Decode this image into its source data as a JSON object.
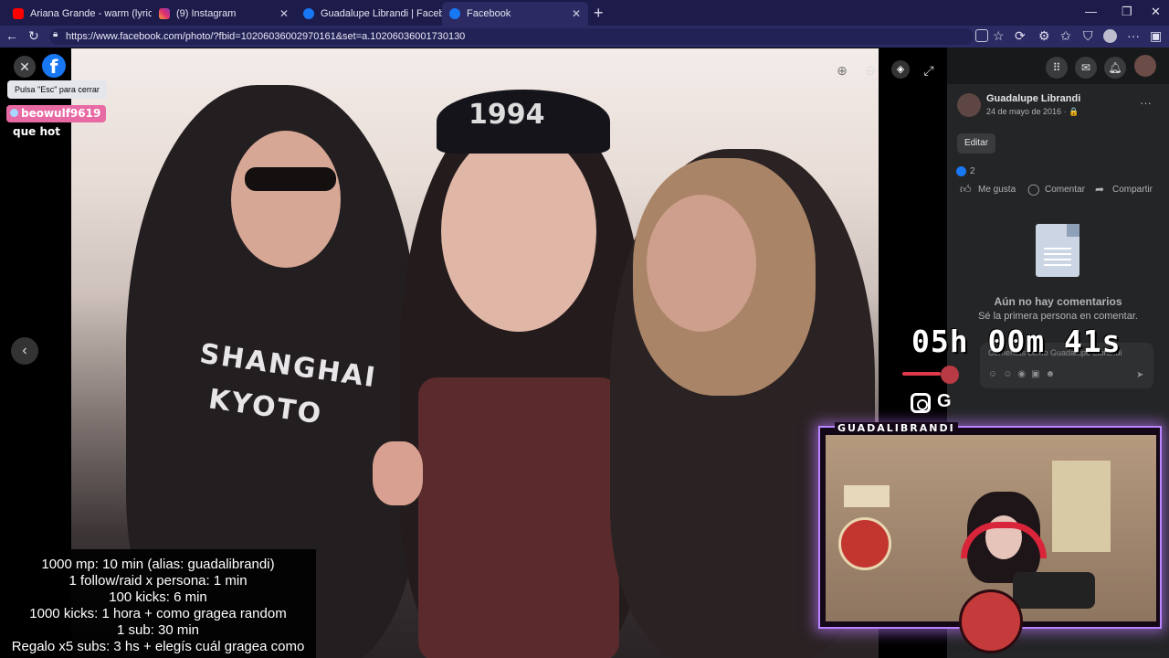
{
  "browser": {
    "tabs": [
      {
        "title": "Ariana Grande - warm (lyric vi",
        "favicon": "youtube-icon"
      },
      {
        "title": "(9) Instagram",
        "favicon": "instagram-icon"
      },
      {
        "title": "Guadalupe Librandi | Facebook",
        "favicon": "facebook-icon"
      },
      {
        "title": "Facebook",
        "favicon": "facebook-icon"
      }
    ],
    "url": "https://www.facebook.com/photo/?fbid=10206036002970161&set=a.10206036001730130"
  },
  "viewer": {
    "close_tooltip": "Pulsa \"Esc\" para cerrar",
    "fb_logo": "f"
  },
  "post": {
    "author": "Guadalupe Librandi",
    "date": "24 de mayo de 2016 · 🔒",
    "edit_label": "Editar",
    "like_count": "2",
    "actions": {
      "like": "Me gusta",
      "comment": "Comentar",
      "share": "Compartir"
    },
    "no_comments_title": "Aún no hay comentarios",
    "no_comments_sub": "Sé la primera persona en comentar.",
    "comment_placeholder": "Comentas como Guadalupe Librandi"
  },
  "overlay": {
    "chat_user": "beowulf9619",
    "chat_message": "que hot",
    "timer": "05h 00m 41s",
    "cam_label": "GUADALIBRANDI",
    "rules": [
      "1000 mp: 10 min (alias: guadalibrandi)",
      "1 follow/raid x persona: 1 min",
      "100 kicks: 6 min",
      "1000 kicks: 1 hora + como gragea random",
      "1 sub: 30 min",
      "Regalo x5 subs: 3 hs + elegís cuál gragea como"
    ]
  },
  "photo": {
    "shirt_text_1": "SHANGHAI",
    "shirt_text_2": "KYOTO",
    "hat_text": "1994"
  },
  "colors": {
    "facebook_blue": "#1877f2",
    "panel_bg": "#242526",
    "browser_bg": "#1c1b4a",
    "cam_glow": "#b884ff"
  }
}
